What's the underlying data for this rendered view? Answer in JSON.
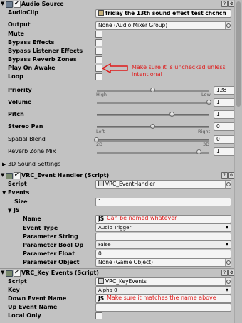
{
  "audio_source": {
    "title": "Audio Source",
    "audio_clip_label": "AudioClip",
    "audio_clip_value": "friday the 13th sound effect test chchch",
    "output_label": "Output",
    "output_value": "None (Audio Mixer Group)",
    "mute_label": "Mute",
    "bypass_effects_label": "Bypass Effects",
    "bypass_listener_label": "Bypass Listener Effects",
    "bypass_reverb_label": "Bypass Reverb Zones",
    "play_on_awake_label": "Play On Awake",
    "loop_label": "Loop",
    "priority_label": "Priority",
    "priority_value": "128",
    "priority_fraction": 0.5,
    "priority_min_label": "High",
    "priority_max_label": "Low",
    "volume_label": "Volume",
    "volume_value": "1",
    "volume_fraction": 1.0,
    "pitch_label": "Pitch",
    "pitch_value": "1",
    "pitch_fraction": 0.67,
    "stereo_pan_label": "Stereo Pan",
    "stereo_pan_value": "0",
    "stereo_pan_fraction": 0.5,
    "stereo_pan_min_label": "Left",
    "stereo_pan_max_label": "Right",
    "spatial_blend_label": "Spatial Blend",
    "spatial_blend_value": "0",
    "spatial_blend_fraction": 0.0,
    "spatial_min_label": "2D",
    "spatial_max_label": "3D",
    "reverb_mix_label": "Reverb Zone Mix",
    "reverb_mix_value": "1",
    "reverb_mix_fraction": 0.91,
    "sound_settings_label": "3D Sound Settings"
  },
  "annotations": {
    "play_on_awake_note": "Make sure it is unchecked unless intentional",
    "js_note": "Can be named whatever",
    "down_event_note": "Make sure it matches the name above"
  },
  "event_handler": {
    "title": "VRC_Event Handler (Script)",
    "script_label": "Script",
    "script_value": "VRC_EventHandler",
    "events_label": "Events",
    "size_label": "Size",
    "size_value": "1",
    "js_label": "JS",
    "name_label": "Name",
    "name_value": "JS",
    "event_type_label": "Event Type",
    "event_type_value": "Audio Trigger",
    "param_string_label": "Parameter String",
    "param_bool_label": "Parameter Bool Op",
    "param_bool_value": "False",
    "param_float_label": "Parameter Float",
    "param_float_value": "0",
    "param_object_label": "Parameter Object",
    "param_object_value": "None (Game Object)"
  },
  "key_events": {
    "title": "VRC_Key Events (Script)",
    "script_label": "Script",
    "script_value": "VRC_KeyEvents",
    "key_label": "Key",
    "key_value": "Alpha 0",
    "down_event_label": "Down Event Name",
    "down_event_value": "JS",
    "up_event_label": "Up Event Name",
    "local_only_label": "Local Only"
  },
  "colors": {
    "background": "#c2c2c2",
    "annotation": "#e01919"
  }
}
